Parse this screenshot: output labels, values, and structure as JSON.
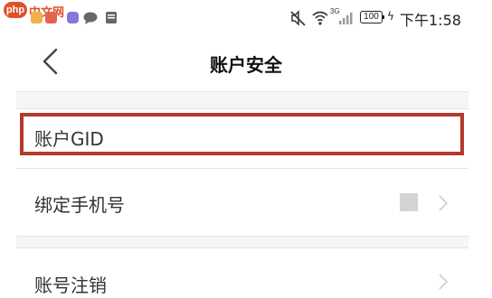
{
  "status_bar": {
    "watermark_logo": "php",
    "watermark_text": "中文网",
    "network_label": "3G",
    "battery": "100",
    "time": "下午1:58"
  },
  "header": {
    "title": "账户安全",
    "back_icon": "chevron-left-icon"
  },
  "rows": [
    {
      "label": "账户GID"
    },
    {
      "label": "绑定手机号"
    },
    {
      "label": "账号注销"
    }
  ],
  "colors": {
    "highlight_border": "#b3392c",
    "logo": "#e0502b",
    "divider": "#e3e3e3",
    "section_gap": "#f6f6f6",
    "chevron": "#cccccc",
    "masked_value": "#d4d4d4"
  }
}
